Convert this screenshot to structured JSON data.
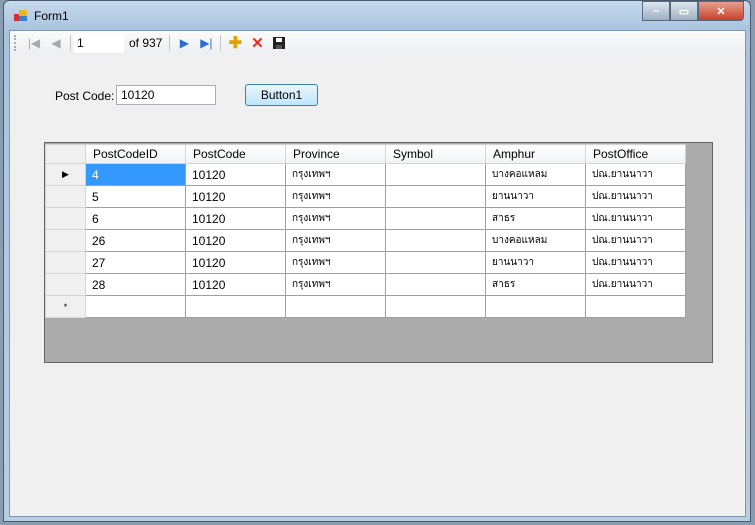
{
  "window": {
    "title": "Form1"
  },
  "navigator": {
    "position": "1",
    "count_label": "of 937"
  },
  "form": {
    "postcode_label": "Post Code:",
    "postcode_value": "10120",
    "button_label": "Button1"
  },
  "grid": {
    "columns": [
      "PostCodeID",
      "PostCode",
      "Province",
      "Symbol",
      "Amphur",
      "PostOffice"
    ],
    "rows": [
      [
        "4",
        "10120",
        "กรุงเทพฯ",
        "",
        "บางคอแหลม",
        "ปณ.ยานนาวา"
      ],
      [
        "5",
        "10120",
        "กรุงเทพฯ",
        "",
        "ยานนาวา",
        "ปณ.ยานนาวา"
      ],
      [
        "6",
        "10120",
        "กรุงเทพฯ",
        "",
        "สาธร",
        "ปณ.ยานนาวา"
      ],
      [
        "26",
        "10120",
        "กรุงเทพฯ",
        "",
        "บางคอแหลม",
        "ปณ.ยานนาวา"
      ],
      [
        "27",
        "10120",
        "กรุงเทพฯ",
        "",
        "ยานนาวา",
        "ปณ.ยานนาวา"
      ],
      [
        "28",
        "10120",
        "กรุงเทพฯ",
        "",
        "สาธร",
        "ปณ.ยานนาวา"
      ]
    ],
    "current_row_marker": "▶",
    "new_row_marker": "*"
  }
}
